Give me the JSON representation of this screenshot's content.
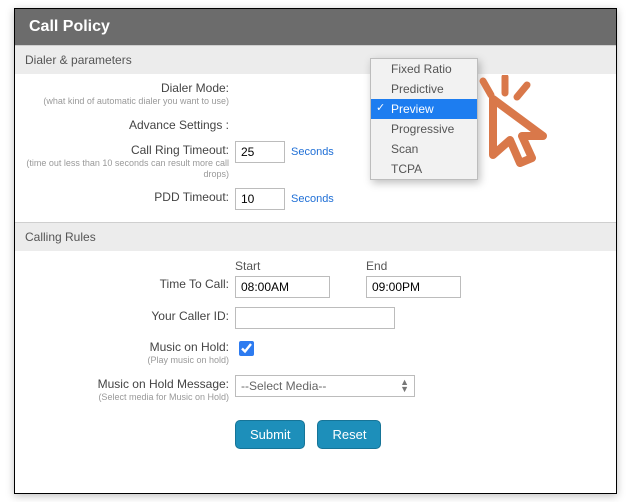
{
  "header": {
    "title": "Call Policy"
  },
  "sections": {
    "dialer": {
      "title": "Dialer & parameters",
      "dialerMode": {
        "label": "Dialer Mode:",
        "hint": "(what kind of automatic dialer you want to use)"
      },
      "advanceSettings": {
        "label": "Advance Settings :"
      },
      "ringTimeout": {
        "label": "Call Ring Timeout:",
        "hint": "(time out less than 10 seconds can result more call drops)",
        "value": "25",
        "unit": "Seconds"
      },
      "pddTimeout": {
        "label": "PDD Timeout:",
        "value": "10",
        "unit": "Seconds"
      }
    },
    "calling": {
      "title": "Calling Rules",
      "timeToCall": {
        "label": "Time To Call:",
        "startLabel": "Start",
        "endLabel": "End",
        "startValue": "08:00AM",
        "endValue": "09:00PM"
      },
      "callerId": {
        "label": "Your Caller ID:",
        "value": ""
      },
      "moh": {
        "label": "Music on Hold:",
        "hint": "(Play music on hold)",
        "checked": true
      },
      "mohMsg": {
        "label": "Music on Hold Message:",
        "hint": "(Select media for Music on Hold)",
        "selected": "--Select Media--"
      }
    }
  },
  "dropdown": {
    "options": [
      "Fixed Ratio",
      "Predictive",
      "Preview",
      "Progressive",
      "Scan",
      "TCPA"
    ],
    "selectedIndex": 2
  },
  "buttons": {
    "submit": "Submit",
    "reset": "Reset"
  }
}
